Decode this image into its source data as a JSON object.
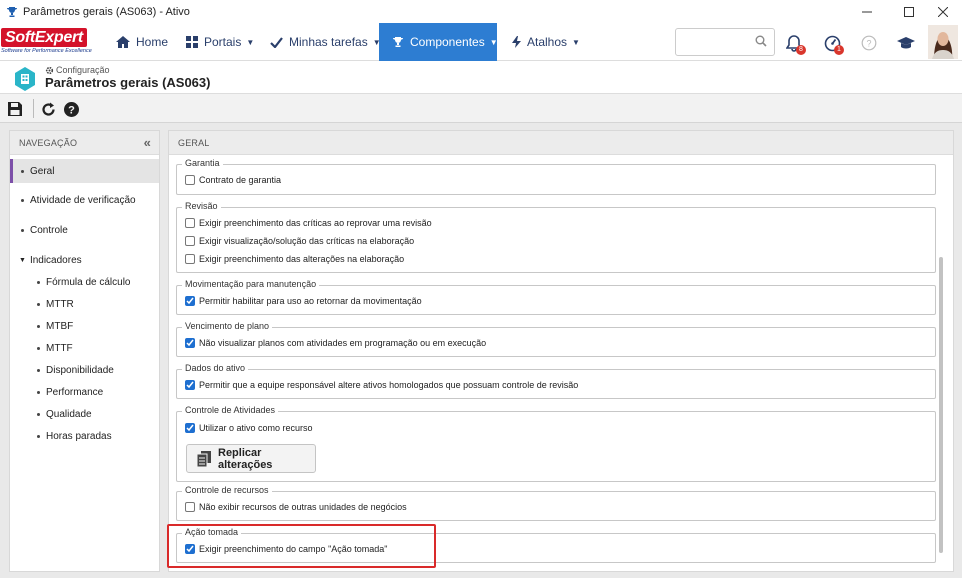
{
  "window": {
    "title": "Parâmetros gerais (AS063) - Ativo",
    "minimize_icon": "minimize-icon",
    "maximize_icon": "maximize-icon",
    "close_icon": "close-icon"
  },
  "brand": {
    "name": "SoftExpert",
    "tagline": "Software for Performance Excellence",
    "color": "#d4122a"
  },
  "nav": {
    "items": [
      {
        "label": "Home",
        "icon": "home-icon"
      },
      {
        "label": "Portais",
        "icon": "grid-icon"
      },
      {
        "label": "Minhas tarefas",
        "icon": "check-icon"
      },
      {
        "label": "Componentes",
        "icon": "trophy-icon"
      },
      {
        "label": "Atalhos",
        "icon": "bolt-icon"
      }
    ],
    "active_color": "#2d7dd2",
    "search_placeholder": "",
    "notifications_badge": "8",
    "alerts_badge": "1"
  },
  "page": {
    "breadcrumb": "Configuração",
    "title": "Parâmetros gerais (AS063)"
  },
  "toolbar": {
    "buttons": [
      "save-icon",
      "refresh-icon",
      "help-icon"
    ]
  },
  "navigation": {
    "heading": "NAVEGAÇÃO",
    "collapse_glyph": "«",
    "items": [
      {
        "label": "Geral",
        "active": true
      },
      {
        "label": "Atividade de verificação"
      },
      {
        "label": "Controle"
      },
      {
        "label": "Indicadores",
        "expanded": true
      },
      {
        "label": "Fórmula de cálculo"
      },
      {
        "label": "MTTR"
      },
      {
        "label": "MTBF"
      },
      {
        "label": "MTTF"
      },
      {
        "label": "Disponibilidade"
      },
      {
        "label": "Performance"
      },
      {
        "label": "Qualidade"
      },
      {
        "label": "Horas paradas"
      }
    ]
  },
  "main": {
    "heading": "GERAL",
    "sections": [
      {
        "legend": "Garantia",
        "options": [
          {
            "label": "Contrato de garantia",
            "checked": false
          }
        ]
      },
      {
        "legend": "Revisão",
        "options": [
          {
            "label": "Exigir preenchimento das críticas ao reprovar uma revisão",
            "checked": false
          },
          {
            "label": "Exigir visualização/solução das críticas na elaboração",
            "checked": false
          },
          {
            "label": "Exigir preenchimento das alterações na elaboração",
            "checked": false
          }
        ]
      },
      {
        "legend": "Movimentação para manutenção",
        "options": [
          {
            "label": "Permitir habilitar para uso ao retornar da movimentação",
            "checked": true
          }
        ]
      },
      {
        "legend": "Vencimento de plano",
        "options": [
          {
            "label": "Não visualizar planos com atividades em programação ou em execução",
            "checked": true
          }
        ]
      },
      {
        "legend": "Dados do ativo",
        "options": [
          {
            "label": "Permitir que a equipe responsável altere ativos homologados que possuam controle de revisão",
            "checked": true
          }
        ]
      },
      {
        "legend": "Controle de Atividades",
        "options": [
          {
            "label": "Utilizar o ativo como recurso",
            "checked": true
          }
        ],
        "button": "Replicar alterações"
      },
      {
        "legend": "Controle de recursos",
        "options": [
          {
            "label": "Não exibir recursos de outras unidades de negócios",
            "checked": false
          }
        ]
      },
      {
        "legend": "Ação tomada",
        "options": [
          {
            "label": "Exigir preenchimento do campo \"Ação tomada\"",
            "checked": true
          }
        ]
      }
    ],
    "checkbox_color": "#1e6fd0",
    "highlight_color": "#d92a2a"
  }
}
